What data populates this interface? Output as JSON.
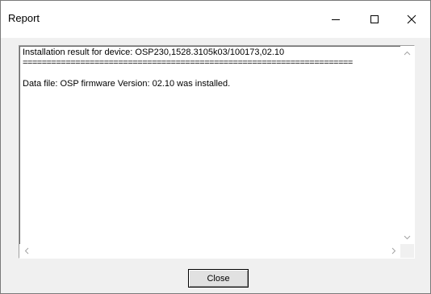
{
  "window": {
    "title": "Report",
    "controls": {
      "minimize_icon": "minimize-icon",
      "maximize_icon": "maximize-icon",
      "close_icon": "close-icon"
    }
  },
  "report": {
    "lines": [
      "Installation result for device: OSP230,1528.3105k03/100173,02.10",
      "=====================================================================",
      "",
      "Data file: OSP firmware Version: 02.10 was installed."
    ]
  },
  "scrollbars": {
    "up_icon": "chevron-up-icon",
    "down_icon": "chevron-down-icon",
    "left_icon": "chevron-left-icon",
    "right_icon": "chevron-right-icon"
  },
  "buttons": {
    "close_label": "Close"
  },
  "colors": {
    "window_bg": "#f0f0f0",
    "titlebar_bg": "#ffffff",
    "button_bg": "#e1e1e1",
    "arrow_disabled": "#a3a3a3"
  }
}
